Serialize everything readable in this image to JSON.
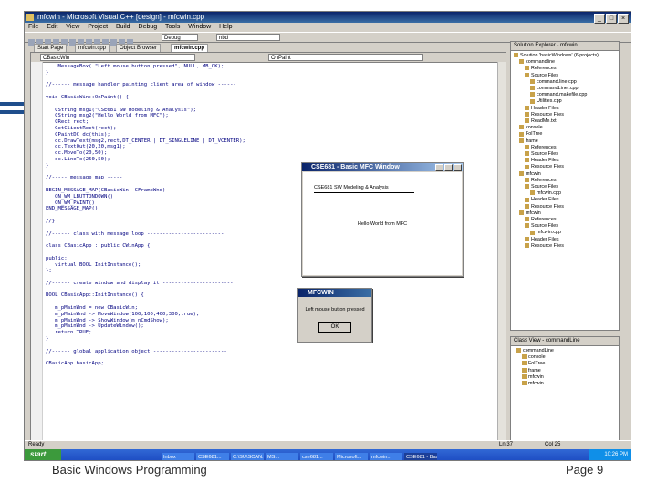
{
  "window": {
    "title": "mfcwin - Microsoft Visual C++ [design] - mfcwin.cpp"
  },
  "menu": [
    "File",
    "Edit",
    "View",
    "Project",
    "Build",
    "Debug",
    "Tools",
    "Window",
    "Help"
  ],
  "toolbar": {
    "config": "Debug",
    "platform": "nbd"
  },
  "tabs": [
    "Start Page",
    "mfcwin.cpp",
    "Object Browser",
    "mfcwin.cpp"
  ],
  "editor": {
    "class_combo": "CBasicWin",
    "method_combo": "OnPaint",
    "lines": [
      "    MessageBox( \"Left mouse button pressed\", NULL, MB_OK);",
      "}",
      "",
      "//------ message handler painting client area of window ------",
      "",
      "void CBasicWin::OnPaint() {",
      "",
      "   CString msg1(\"CSE681 SW Modeling & Analysis\");",
      "   CString msg2(\"Hello World from MFC\");",
      "   CRect rect;",
      "   GetClientRect(rect);",
      "   CPaintDC dc(this);",
      "   dc.DrawText(msg2,rect,DT_CENTER | DT_SINGLELINE | DT_VCENTER);",
      "   dc.TextOut(20,20,msg1);",
      "   dc.MoveTo(20,50);",
      "   dc.LineTo(250,50);",
      "}",
      "",
      "//----- message map -----",
      "",
      "BEGIN_MESSAGE_MAP(CBasicWin, CFrameWnd)",
      "   ON_WM_LBUTTONDOWN()",
      "   ON_WM_PAINT()",
      "END_MESSAGE_MAP()",
      "",
      "//}",
      "",
      "//------ class with message loop -------------------------",
      "",
      "class CBasicApp : public CWinApp {",
      "",
      "public:",
      "   virtual BOOL InitInstance();",
      "};",
      "",
      "//------ create window and display it -----------------------",
      "",
      "BOOL CBasicApp::InitInstance() {",
      "",
      "   m_pMainWnd = new CBasicWin;",
      "   m_pMainWnd -> MoveWindow(100,100,400,300,true);",
      "   m_pMainWnd -> ShowWindow(m_nCmdShow);",
      "   m_pMainWnd -> UpdateWindow();",
      "   return TRUE;",
      "}",
      "",
      "//------ global application object ------------------------",
      "",
      "CBasicApp basicApp;"
    ]
  },
  "solution_explorer": {
    "title": "Solution Explorer - mfcwin",
    "items": [
      "Solution 'basicWindows' (6 projects)",
      "commandline",
      "References",
      "Source Files",
      "command.line.cpp",
      "commandLineI.cpp",
      "command.makefile.cpp",
      "Utilities.cpp",
      "Header Files",
      "Resource Files",
      "ReadMe.txt",
      "console",
      "FolTree",
      "frame",
      "References",
      "Source Files",
      "Header Files",
      "Resource Files",
      "mfcwin",
      "References",
      "Source Files",
      "mfcwin.cpp",
      "Header Files",
      "Resource Files",
      "mfcwin",
      "References",
      "Source Files",
      "mfcwin.cpp",
      "Header Files",
      "Resource Files"
    ]
  },
  "class_view": {
    "title": "Class View - commandLine",
    "items": [
      "commandLine",
      "console",
      "FolTree",
      "frame",
      "mfcwin",
      "mfcwin"
    ]
  },
  "status": {
    "left": "Ready",
    "pos": "Ln 37",
    "col": "Col 25"
  },
  "taskbar": {
    "start": "start",
    "tasks": [
      "Inbox",
      "CSE681...",
      "C:\\SU\\SCAN...",
      "MS...",
      "cse681...",
      "Microsoft...",
      "mfcwin...",
      "CSE681 - Bas..."
    ],
    "clock": "10:26 PM"
  },
  "mfc_window": {
    "title": "CSE681 - Basic MFC Window",
    "msg1": "CSE681 SW Modeling & Analysis",
    "msg2": "Hello World from MFC"
  },
  "msgbox": {
    "title": "MFCWIN",
    "text": "Left mouse button pressed",
    "ok": "OK"
  },
  "footer": {
    "left": "Basic Windows Programming",
    "right": "Page 9"
  }
}
